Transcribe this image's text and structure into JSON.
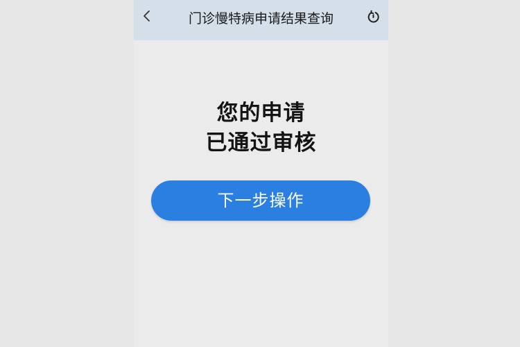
{
  "header": {
    "back_icon": "chevron-left-icon",
    "title": "门诊慢特病申请结果查询",
    "refresh_icon": "refresh-icon"
  },
  "result": {
    "line1": "您的申请",
    "line2": "已通过审核"
  },
  "actions": {
    "next_label": "下一步操作"
  },
  "colors": {
    "background": "#e6e6e6",
    "page": "#ebebeb",
    "header": "#d4dfe9",
    "primary_button": "#2a7fe0",
    "text": "#141414"
  }
}
